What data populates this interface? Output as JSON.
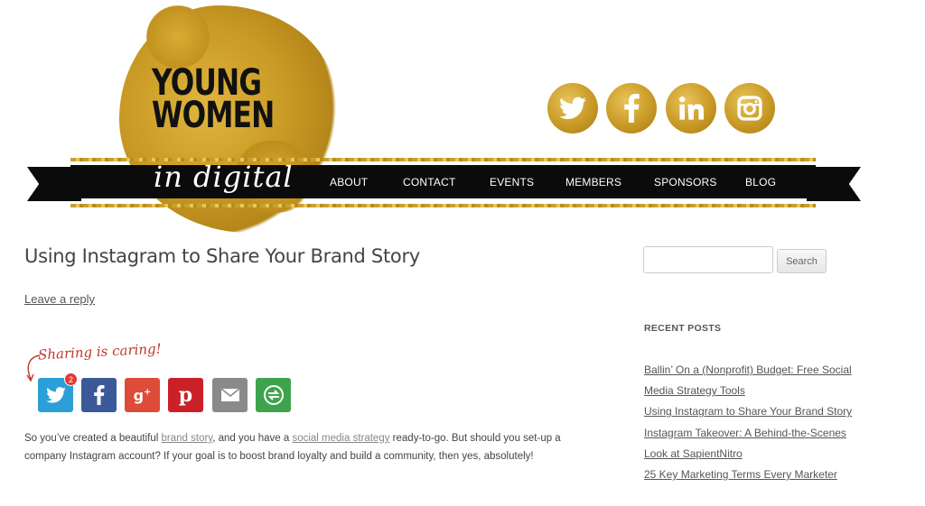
{
  "site": {
    "logo_lines": [
      "YOUNG",
      "WOMEN"
    ],
    "logo_script": "in digital",
    "brand_gold": "#c99a26",
    "banner_color": "#0b0b0b"
  },
  "nav": {
    "items": [
      {
        "label": "ABOUT"
      },
      {
        "label": "CONTACT"
      },
      {
        "label": "EVENTS"
      },
      {
        "label": "MEMBERS"
      },
      {
        "label": "SPONSORS"
      },
      {
        "label": "BLOG"
      }
    ]
  },
  "social_icons": [
    "twitter-icon",
    "facebook-icon",
    "linkedin-icon",
    "instagram-icon"
  ],
  "post": {
    "title": "Using Instagram to Share Your Brand Story",
    "reply_label": "Leave a reply",
    "sharing_label": "Sharing is caring!",
    "twitter_count": "2",
    "share_buttons": [
      {
        "icon": "twitter-icon",
        "color": "#2a9fd8"
      },
      {
        "icon": "facebook-icon",
        "color": "#3b5998"
      },
      {
        "icon": "googleplus-icon",
        "color": "#dd4b39"
      },
      {
        "icon": "pinterest-icon",
        "color": "#cb2027"
      },
      {
        "icon": "email-icon",
        "color": "#8a8a8a"
      },
      {
        "icon": "more-share-icon",
        "color": "#3fa34d"
      }
    ],
    "body": {
      "part1": "So you’ve created a beautiful ",
      "link1": "brand story",
      "part2": ", and you have a ",
      "link2": "social media strategy",
      "part3": " ready-to-go. But should you set-up a company Instagram account? If your goal is to boost brand loyalty and build a community, then yes, absolutely!"
    }
  },
  "sidebar": {
    "search_placeholder": "",
    "search_button": "Search",
    "recent_title": "RECENT POSTS",
    "recent_posts": [
      {
        "title": "Ballin’ On a (Nonprofit) Budget: Free Social Media Strategy Tools"
      },
      {
        "title": "Using Instagram to Share Your Brand Story"
      },
      {
        "title": "Instagram Takeover: A Behind-the-Scenes Look at SapientNitro"
      },
      {
        "title": "25 Key Marketing Terms Every Marketer"
      }
    ]
  }
}
